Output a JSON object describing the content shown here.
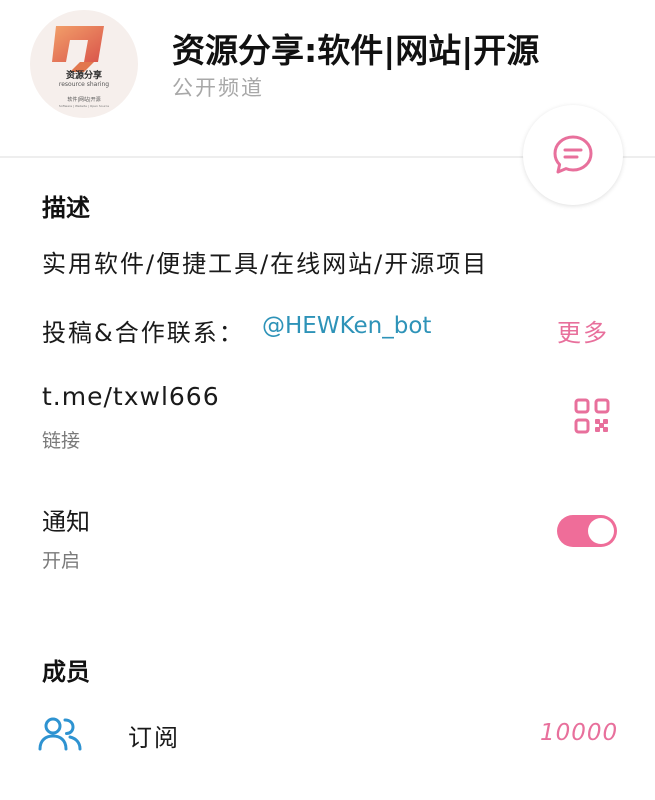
{
  "header": {
    "avatar": {
      "line1": "资源分享",
      "line2": "resource sharing",
      "line3": "软件|网站|开源",
      "line4": "Software | Website | Open Source"
    },
    "title": "资源分享:软件|网站|开源",
    "type": "公开频道"
  },
  "description": {
    "title": "描述",
    "text": "实用软件/便捷工具/在线网站/开源项目",
    "contact_label": "投稿&合作联系：",
    "contact_handle": "@HEWKen_bot",
    "more_label": "更多"
  },
  "link": {
    "value": "t.me/txwl666",
    "caption": "链接"
  },
  "notifications": {
    "label": "通知",
    "state": "开启",
    "enabled": true
  },
  "members": {
    "title": "成员",
    "subscribe_label": "订阅",
    "subscribe_count": "10000"
  },
  "icons": {
    "chat": "chat-bubble-icon",
    "qr": "qr-code-icon",
    "members": "members-icon"
  },
  "colors": {
    "accent": "#e8709c",
    "toggle_on": "#ef6d99",
    "link": "#2e93b8",
    "secondary_text": "#7a7a7a"
  }
}
